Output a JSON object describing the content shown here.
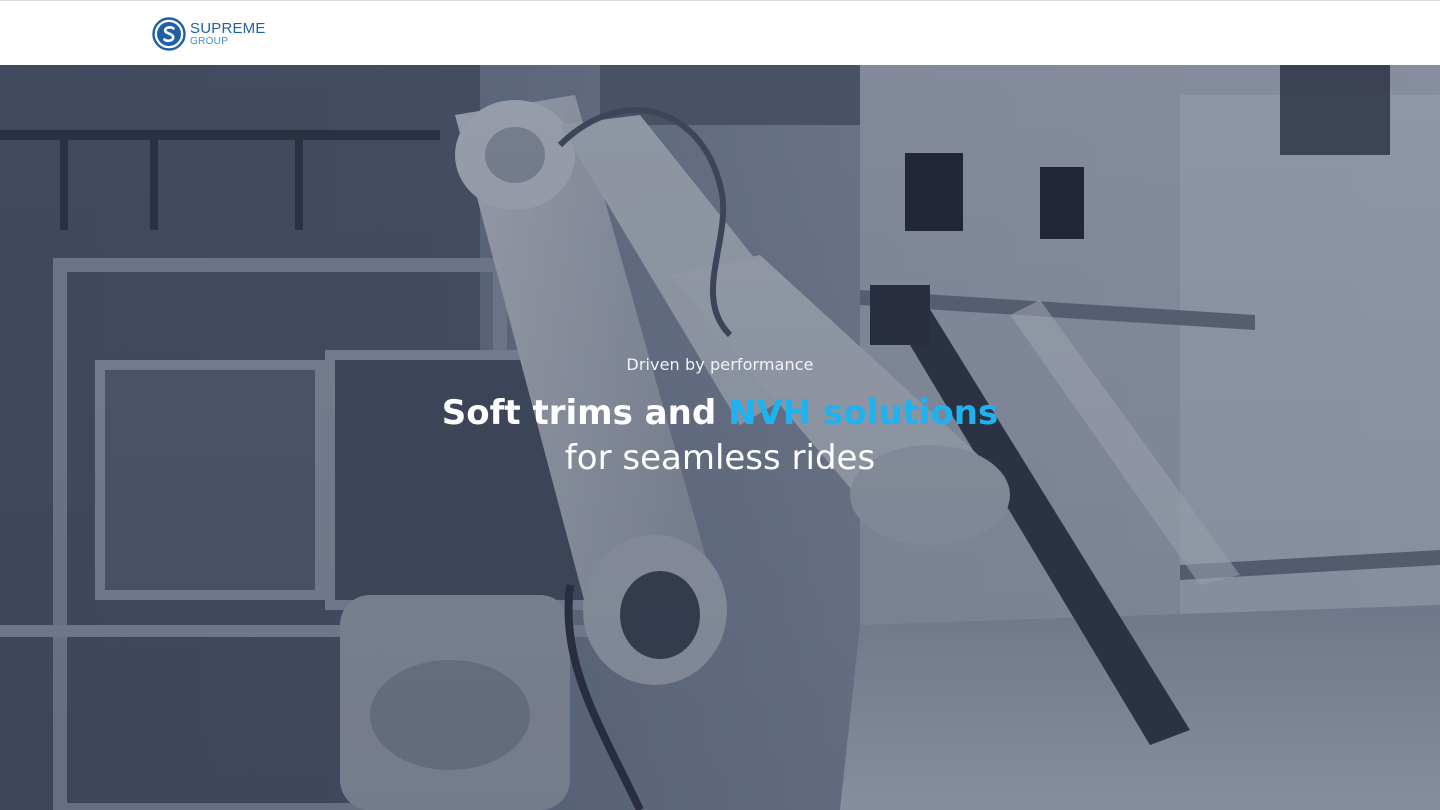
{
  "header": {
    "logo": {
      "name": "SUPREME",
      "sub": "GROUP",
      "colors": {
        "primary": "#1f5fa8",
        "secondary": "#3f8fd6"
      }
    }
  },
  "hero": {
    "eyebrow": "Driven by performance",
    "headline_lead": "Soft trims and",
    "headline_accent": "NVH solutions",
    "subline": "for seamless rides",
    "colors": {
      "accent": "#1fb2f0",
      "text": "#ffffff"
    }
  }
}
